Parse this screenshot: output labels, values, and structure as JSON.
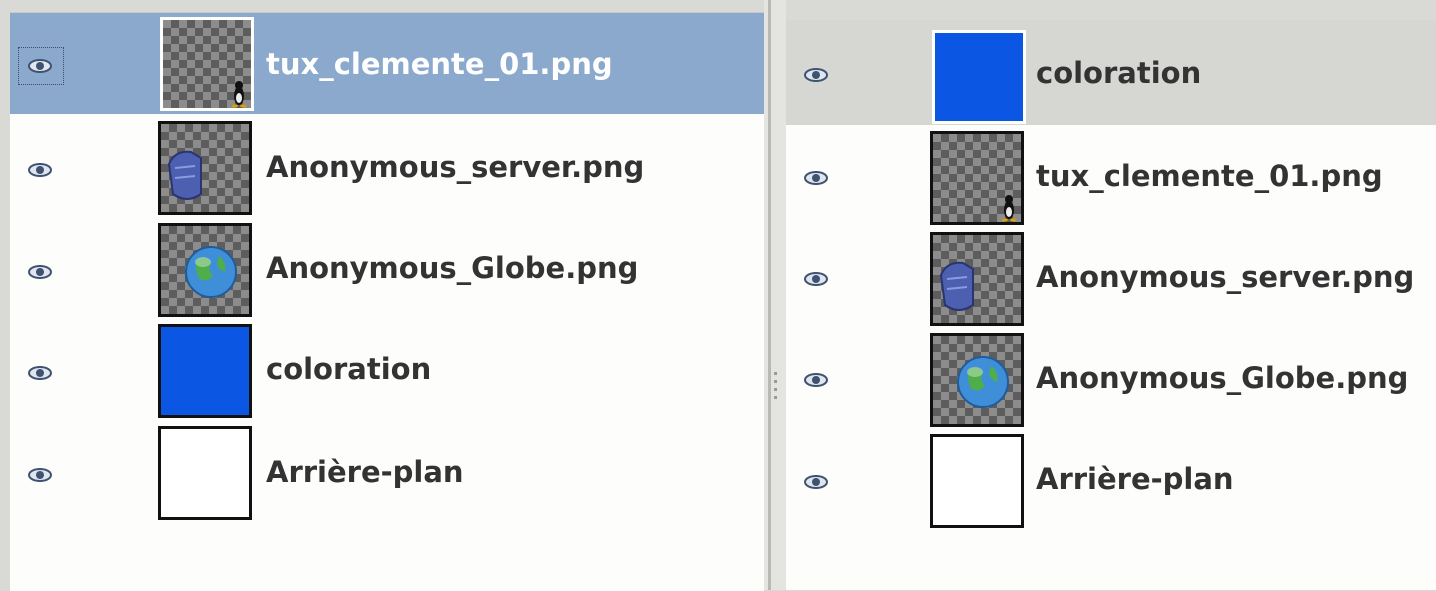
{
  "left_panel": {
    "layers": [
      {
        "name": "tux_clemente_01.png",
        "thumbnail": "tux-penguin-on-transparent",
        "selected": true
      },
      {
        "name": "Anonymous_server.png",
        "thumbnail": "server-icon-on-transparent"
      },
      {
        "name": "Anonymous_Globe.png",
        "thumbnail": "globe-icon-on-transparent"
      },
      {
        "name": "coloration",
        "thumbnail": "solid-blue"
      },
      {
        "name": "Arrière-plan",
        "thumbnail": "solid-white"
      }
    ]
  },
  "right_panel": {
    "layers": [
      {
        "name": "coloration",
        "thumbnail": "solid-blue",
        "selected": true
      },
      {
        "name": "tux_clemente_01.png",
        "thumbnail": "tux-penguin-on-transparent"
      },
      {
        "name": "Anonymous_server.png",
        "thumbnail": "server-icon-on-transparent"
      },
      {
        "name": "Anonymous_Globe.png",
        "thumbnail": "globe-icon-on-transparent"
      },
      {
        "name": "Arrière-plan",
        "thumbnail": "solid-white"
      }
    ]
  },
  "colors": {
    "selection_blue": "#8aa9cd",
    "selection_grey": "#d6d6d3",
    "layer_blue": "#0b57e3",
    "eye_color": "#3f5270"
  },
  "icons": {
    "visibility": "eye-icon"
  }
}
